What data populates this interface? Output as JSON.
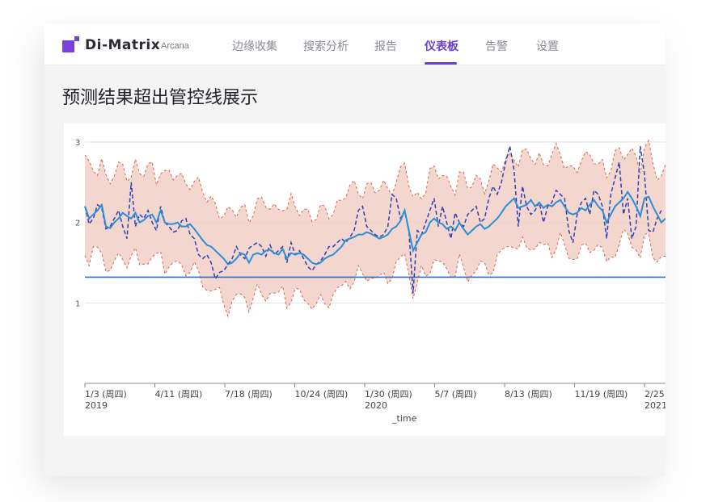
{
  "app": {
    "brand": "Di-Matrix",
    "sub": "Arcana"
  },
  "nav": {
    "tabs": [
      {
        "label": "边缘收集"
      },
      {
        "label": "搜索分析"
      },
      {
        "label": "报告"
      },
      {
        "label": "仪表板",
        "active": true
      },
      {
        "label": "告警"
      },
      {
        "label": "设置"
      }
    ]
  },
  "page": {
    "title": "预测结果超出管控线展示"
  },
  "colors": {
    "accent": "#6b3fd4",
    "band": "#f1cfc5",
    "band_edge": "#d9624a",
    "predicted": "#2b8fd6",
    "actual": "#2f3fb3",
    "control": "#2f6fd0"
  },
  "chart_data": {
    "type": "line",
    "xlabel": "_time",
    "ylim": [
      0,
      3
    ],
    "yticks": [
      1,
      2,
      3
    ],
    "x_ticks": [
      {
        "label": "1/3 (周四)",
        "year": "2019"
      },
      {
        "label": "4/11 (周四)",
        "year": ""
      },
      {
        "label": "7/18 (周四)",
        "year": ""
      },
      {
        "label": "10/24 (周四)",
        "year": ""
      },
      {
        "label": "1/30 (周四)",
        "year": "2020"
      },
      {
        "label": "5/7 (周四)",
        "year": ""
      },
      {
        "label": "8/13 (周四)",
        "year": ""
      },
      {
        "label": "11/19 (周四)",
        "year": ""
      },
      {
        "label": "2/25",
        "year": "2021"
      }
    ],
    "control_line": 1.32,
    "predicted": [
      2.2,
      2.05,
      2.1,
      2.15,
      2.22,
      1.95,
      1.93,
      2.0,
      2.05,
      2.12,
      2.08,
      2.05,
      2.12,
      2.0,
      2.03,
      2.08,
      2.1,
      2.0,
      2.15,
      2.0,
      1.98,
      1.98,
      2.0,
      1.95,
      1.95,
      1.98,
      1.92,
      1.85,
      1.78,
      1.72,
      1.7,
      1.65,
      1.6,
      1.55,
      1.48,
      1.5,
      1.55,
      1.62,
      1.6,
      1.5,
      1.6,
      1.62,
      1.6,
      1.65,
      1.66,
      1.62,
      1.6,
      1.67,
      1.55,
      1.62,
      1.6,
      1.62,
      1.6,
      1.55,
      1.5,
      1.48,
      1.5,
      1.55,
      1.58,
      1.6,
      1.65,
      1.7,
      1.78,
      1.8,
      1.82,
      1.85,
      1.85,
      1.88,
      1.86,
      1.83,
      1.8,
      1.82,
      1.85,
      1.92,
      1.95,
      2.02,
      2.15,
      1.9,
      1.65,
      1.75,
      1.85,
      1.88,
      2.0,
      2.05,
      2.0,
      1.98,
      1.92,
      1.95,
      1.9,
      2.0,
      1.92,
      1.85,
      1.9,
      1.95,
      1.98,
      1.92,
      1.95,
      2.0,
      2.05,
      2.12,
      2.2,
      2.25,
      2.3,
      2.18,
      2.2,
      2.22,
      2.28,
      2.2,
      2.25,
      2.18,
      2.22,
      2.2,
      2.25,
      2.28,
      2.2,
      2.12,
      2.1,
      2.12,
      2.18,
      2.15,
      2.22,
      2.28,
      2.2,
      2.15,
      2.0,
      2.1,
      2.2,
      2.25,
      2.3,
      2.38,
      2.3,
      2.2,
      2.08,
      2.3,
      2.32,
      2.2,
      2.1,
      2.0,
      2.05
    ],
    "actual": [
      2.2,
      1.98,
      2.05,
      2.22,
      2.18,
      1.92,
      1.95,
      2.05,
      2.15,
      1.95,
      1.8,
      2.5,
      1.95,
      2.1,
      2.05,
      2.15,
      2.0,
      1.9,
      2.2,
      2.0,
      1.95,
      1.88,
      1.9,
      2.02,
      2.05,
      1.85,
      1.8,
      1.6,
      1.55,
      1.6,
      1.5,
      1.3,
      1.38,
      1.4,
      1.48,
      1.55,
      1.7,
      1.6,
      1.55,
      1.68,
      1.72,
      1.75,
      1.7,
      1.58,
      1.72,
      1.6,
      1.65,
      1.7,
      1.5,
      1.75,
      1.6,
      1.65,
      1.55,
      1.45,
      1.4,
      1.48,
      1.52,
      1.6,
      1.7,
      1.7,
      1.75,
      1.8,
      1.75,
      1.82,
      1.9,
      2.15,
      2.2,
      1.95,
      1.9,
      1.85,
      1.82,
      1.85,
      1.95,
      2.35,
      2.3,
      2.05,
      2.15,
      1.9,
      1.12,
      1.9,
      1.85,
      2.0,
      2.15,
      2.3,
      1.95,
      2.2,
      2.0,
      1.8,
      2.12,
      2.0,
      1.95,
      2.1,
      2.15,
      2.2,
      2.0,
      2.05,
      2.3,
      2.45,
      2.35,
      2.5,
      2.75,
      2.95,
      2.65,
      1.95,
      2.45,
      2.2,
      2.1,
      2.15,
      2.25,
      2.0,
      2.2,
      2.25,
      2.4,
      2.35,
      2.3,
      1.9,
      1.75,
      2.1,
      2.25,
      2.3,
      2.1,
      2.4,
      2.35,
      2.2,
      1.8,
      2.35,
      2.55,
      2.75,
      2.1,
      2.3,
      1.8,
      1.95,
      2.95,
      2.6,
      1.9,
      1.88,
      2.05,
      2.15
    ]
  }
}
